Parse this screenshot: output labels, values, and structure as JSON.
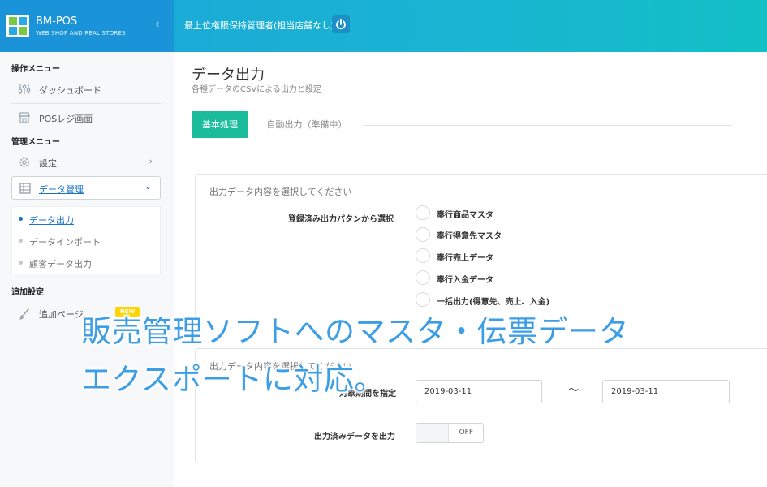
{
  "header": {
    "brand_name": "BM-POS",
    "brand_sub": "WEB SHOP AND REAL STORES",
    "collapse_glyph": "‹",
    "user_name": "最上位権限保持管理者(担当店舗なし)",
    "power_icon": "power-icon"
  },
  "sidebar": {
    "section_ops": "操作メニュー",
    "dashboard": "ダッシュボード",
    "pos_register": "POSレジ画面",
    "section_admin": "管理メニュー",
    "settings": "設定",
    "data_management": "データ管理",
    "submenu": [
      "データ出力",
      "データインポート",
      "顧客データ出力"
    ],
    "section_extra": "追加設定",
    "add_page": "追加ページ",
    "new_badge": "NEW",
    "chevron_right": "›",
    "chevron_down": "⌄"
  },
  "main": {
    "title": "データ出力",
    "subtitle": "各種データのCSVによる出力と設定",
    "tabs": [
      "基本処理",
      "自動出力（準備中）"
    ],
    "panel1": {
      "title": "出力データ内容を選択してください",
      "field_label": "登録済み出力パタンから選択",
      "options": [
        "奉行商品マスタ",
        "奉行得意先マスタ",
        "奉行売上データ",
        "奉行入金データ",
        "一括出力(得意先、売上、入金)"
      ]
    },
    "panel2": {
      "title": "出力データ内容を選択してください",
      "date_label": "対象期間を指定",
      "date_from": "2019-03-11",
      "tilde": "～",
      "date_to": "2019-03-11",
      "exported_label": "出力済みデータを出力",
      "toggle_state": "OFF"
    }
  },
  "overlay": {
    "line1": "販売管理ソフトへのマスタ・伝票データ",
    "line2": "エクスポートに対応。"
  }
}
